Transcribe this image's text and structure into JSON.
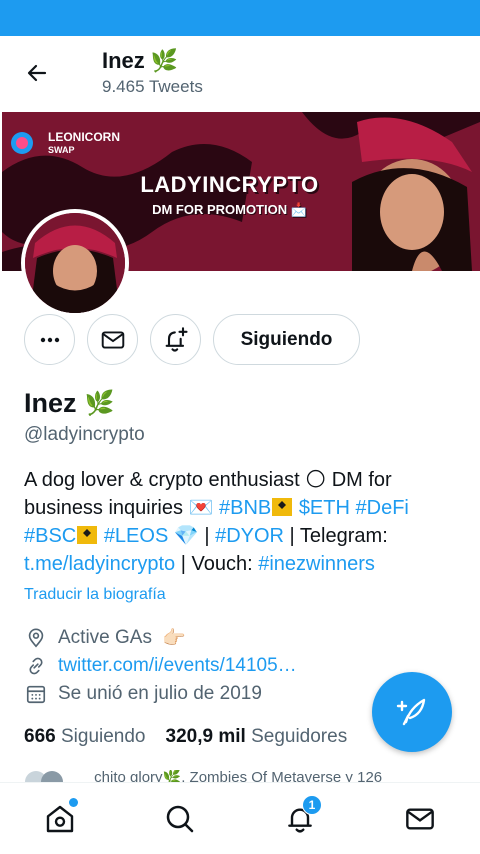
{
  "header": {
    "name": "Inez",
    "name_emoji": "🌿",
    "tweet_count": "9.465 Tweets"
  },
  "banner": {
    "brand_line1": "LEONICORN",
    "brand_line2": "SWAP",
    "headline": "LADYINCRYPTO",
    "subline": "DM FOR PROMOTION",
    "colors": {
      "background": "#7a1530",
      "accent": "#2a0712"
    }
  },
  "actions": {
    "more_icon": "more-icon",
    "message_icon": "mail-icon",
    "notify_icon": "bell-plus-icon",
    "following_label": "Siguiendo"
  },
  "profile": {
    "name": "Inez",
    "name_emoji": "🌿",
    "handle": "@ladyincrypto",
    "bio": {
      "t1": "A dog lover & crypto enthusiast ",
      "e1": "🌕",
      "t2": " DM for business inquiries ",
      "e2": "💌",
      "tag_bnb": "#BNB",
      "tag_eth": "$ETH",
      "tag_defi": "#DeFi",
      "tag_bsc": "#BSC",
      "tag_leos": "#LEOS",
      "e3": "💎",
      "sep1": " | ",
      "tag_dyor": "#DYOR",
      "t3": " | Telegram: ",
      "telegram": "t.me/ladyincrypto",
      "t4": " | Vouch: ",
      "tag_winners": "#inezwinners"
    },
    "translate": "Traducir la biografía",
    "location": "Active GAs",
    "location_emoji": "👉🏻",
    "website": "twitter.com/i/events/14105…",
    "joined": "Se unió en julio de 2019",
    "following_count": "666",
    "following_label": "Siguiendo",
    "followers_count": "320,9 mil",
    "followers_label": "Seguidores",
    "followed_by": "chito glory🌿, Zombies Of Metaverse y 126"
  },
  "fab": {
    "icon": "compose-tweet-icon"
  },
  "bottom_nav": {
    "items": [
      "home-icon",
      "search-icon",
      "notifications-icon",
      "messages-icon"
    ],
    "notifications_badge": "1"
  },
  "colors": {
    "accent": "#1d9bf0",
    "text": "#0f1419",
    "muted": "#536471",
    "border": "#cfd9de"
  }
}
